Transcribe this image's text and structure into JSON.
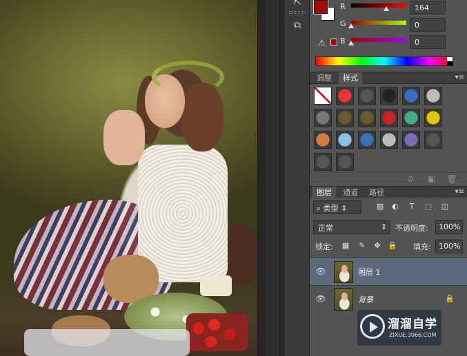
{
  "color_panel": {
    "channels": [
      {
        "label": "R",
        "value": "164",
        "fraction": 0.64
      },
      {
        "label": "G",
        "value": "0",
        "fraction": 0.0
      },
      {
        "label": "B",
        "value": "0",
        "fraction": 0.0
      }
    ],
    "foreground_color": "#a40a0a",
    "background_color": "#ffffff",
    "gamut_warning_icon": "warning-triangle-icon"
  },
  "styles_panel": {
    "tabs": [
      {
        "label": "调整",
        "active": false
      },
      {
        "label": "样式",
        "active": true
      }
    ],
    "swatches": [
      [
        "none",
        "#e33",
        "#555",
        "#222",
        "#3a6fc0",
        "#bdbdbd"
      ],
      [
        "#777",
        "#6b5a2e",
        "#6b5a2e",
        "#c22",
        "#4a8",
        "#e5c400"
      ],
      [
        "#d47a3a",
        "#8cc0e8",
        "#3a72b8",
        "#bbb",
        "#7a6ab8",
        "#555"
      ],
      [
        "#555",
        "#555"
      ]
    ]
  },
  "layers_panel": {
    "tabs": [
      {
        "label": "图层",
        "active": true
      },
      {
        "label": "通道",
        "active": false
      },
      {
        "label": "路径",
        "active": false
      }
    ],
    "filter_kind": "类型",
    "blend_mode": "正常",
    "opacity_label": "不透明度:",
    "opacity_value": "100%",
    "lock_label": "锁定:",
    "fill_label": "填充:",
    "fill_value": "100%",
    "layers": [
      {
        "name": "图层 1",
        "selected": true,
        "visible": true,
        "locked": false
      },
      {
        "name": "背景",
        "selected": false,
        "visible": true,
        "locked": true
      }
    ]
  },
  "watermark": {
    "title": "溜溜自学",
    "url": "ZIXUE.3066.COM"
  }
}
